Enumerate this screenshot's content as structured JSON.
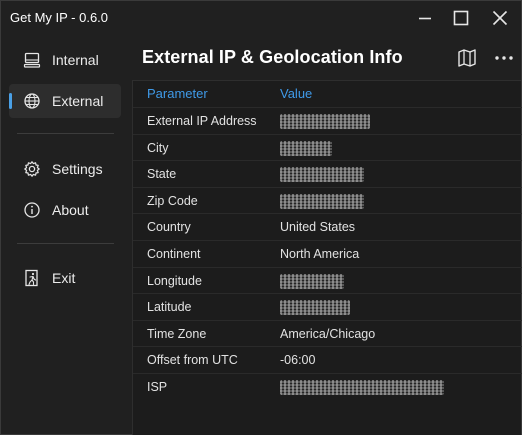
{
  "window": {
    "title": "Get My IP - 0.6.0"
  },
  "sidebar": {
    "items": [
      {
        "label": "Internal",
        "icon": "computer-icon"
      },
      {
        "label": "External",
        "icon": "globe-icon",
        "active": true
      },
      {
        "label": "Settings",
        "icon": "gear-icon"
      },
      {
        "label": "About",
        "icon": "info-icon"
      },
      {
        "label": "Exit",
        "icon": "exit-icon"
      }
    ]
  },
  "main": {
    "title": "External IP & Geolocation Info",
    "actions": [
      "map-icon",
      "more-icon"
    ],
    "table": {
      "headers": {
        "parameter": "Parameter",
        "value": "Value"
      },
      "rows": [
        {
          "parameter": "External IP Address",
          "value": null,
          "redacted": true
        },
        {
          "parameter": "City",
          "value": null,
          "redacted": true
        },
        {
          "parameter": "State",
          "value": null,
          "redacted": true
        },
        {
          "parameter": "Zip Code",
          "value": null,
          "redacted": true
        },
        {
          "parameter": "Country",
          "value": "United States"
        },
        {
          "parameter": "Continent",
          "value": "North America"
        },
        {
          "parameter": "Longitude",
          "value": null,
          "redacted": true
        },
        {
          "parameter": "Latitude",
          "value": null,
          "redacted": true
        },
        {
          "parameter": "Time Zone",
          "value": "America/Chicago"
        },
        {
          "parameter": "Offset from UTC",
          "value": "-06:00"
        },
        {
          "parameter": "ISP",
          "value": null,
          "redacted": true
        }
      ]
    }
  },
  "colors": {
    "background": "#202020",
    "table_background": "#1c1c1c",
    "accent": "#3f9ae8",
    "active_item": "#2d2d2d",
    "text": "#e2e2e2"
  }
}
